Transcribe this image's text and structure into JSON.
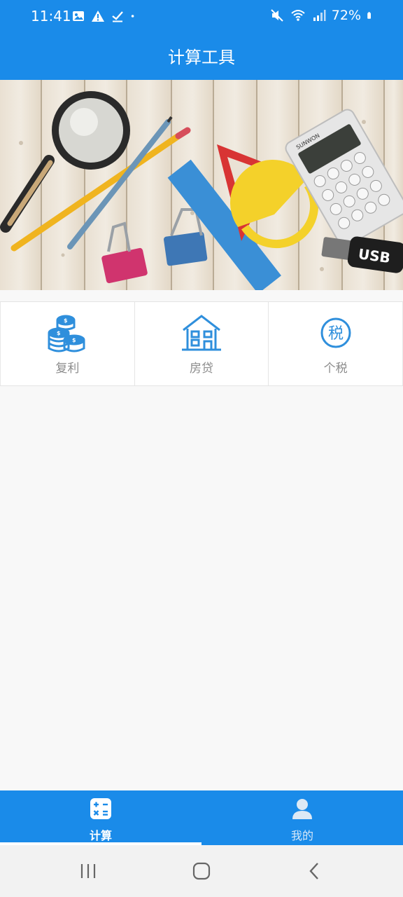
{
  "status_bar": {
    "time": "11:41",
    "left_icons": [
      "image-icon",
      "warning-icon",
      "check-icon",
      "dot-icon"
    ],
    "right_icons": [
      "mute-icon",
      "wifi-icon",
      "signal-icon",
      "battery-icon"
    ],
    "battery_percent": "72%"
  },
  "app_bar": {
    "title": "计算工具"
  },
  "banner": {
    "calculator_brand": "SUNWON",
    "usb_label": "USB"
  },
  "tools": [
    {
      "label": "复利",
      "icon": "coins-icon"
    },
    {
      "label": "房贷",
      "icon": "house-icon"
    },
    {
      "label": "个税",
      "icon": "tax-icon",
      "glyph": "税"
    }
  ],
  "bottom_nav": {
    "items": [
      {
        "label": "计算",
        "icon": "calculator-icon",
        "active": true
      },
      {
        "label": "我的",
        "icon": "person-icon",
        "active": false
      }
    ]
  },
  "system_nav": {
    "buttons": [
      "recent-apps-button",
      "home-button",
      "back-button"
    ]
  },
  "colors": {
    "primary": "#1a8be9",
    "tool_icon": "#2f8fdc",
    "tool_label": "#8c8c8c",
    "background": "#f8f8f8"
  }
}
